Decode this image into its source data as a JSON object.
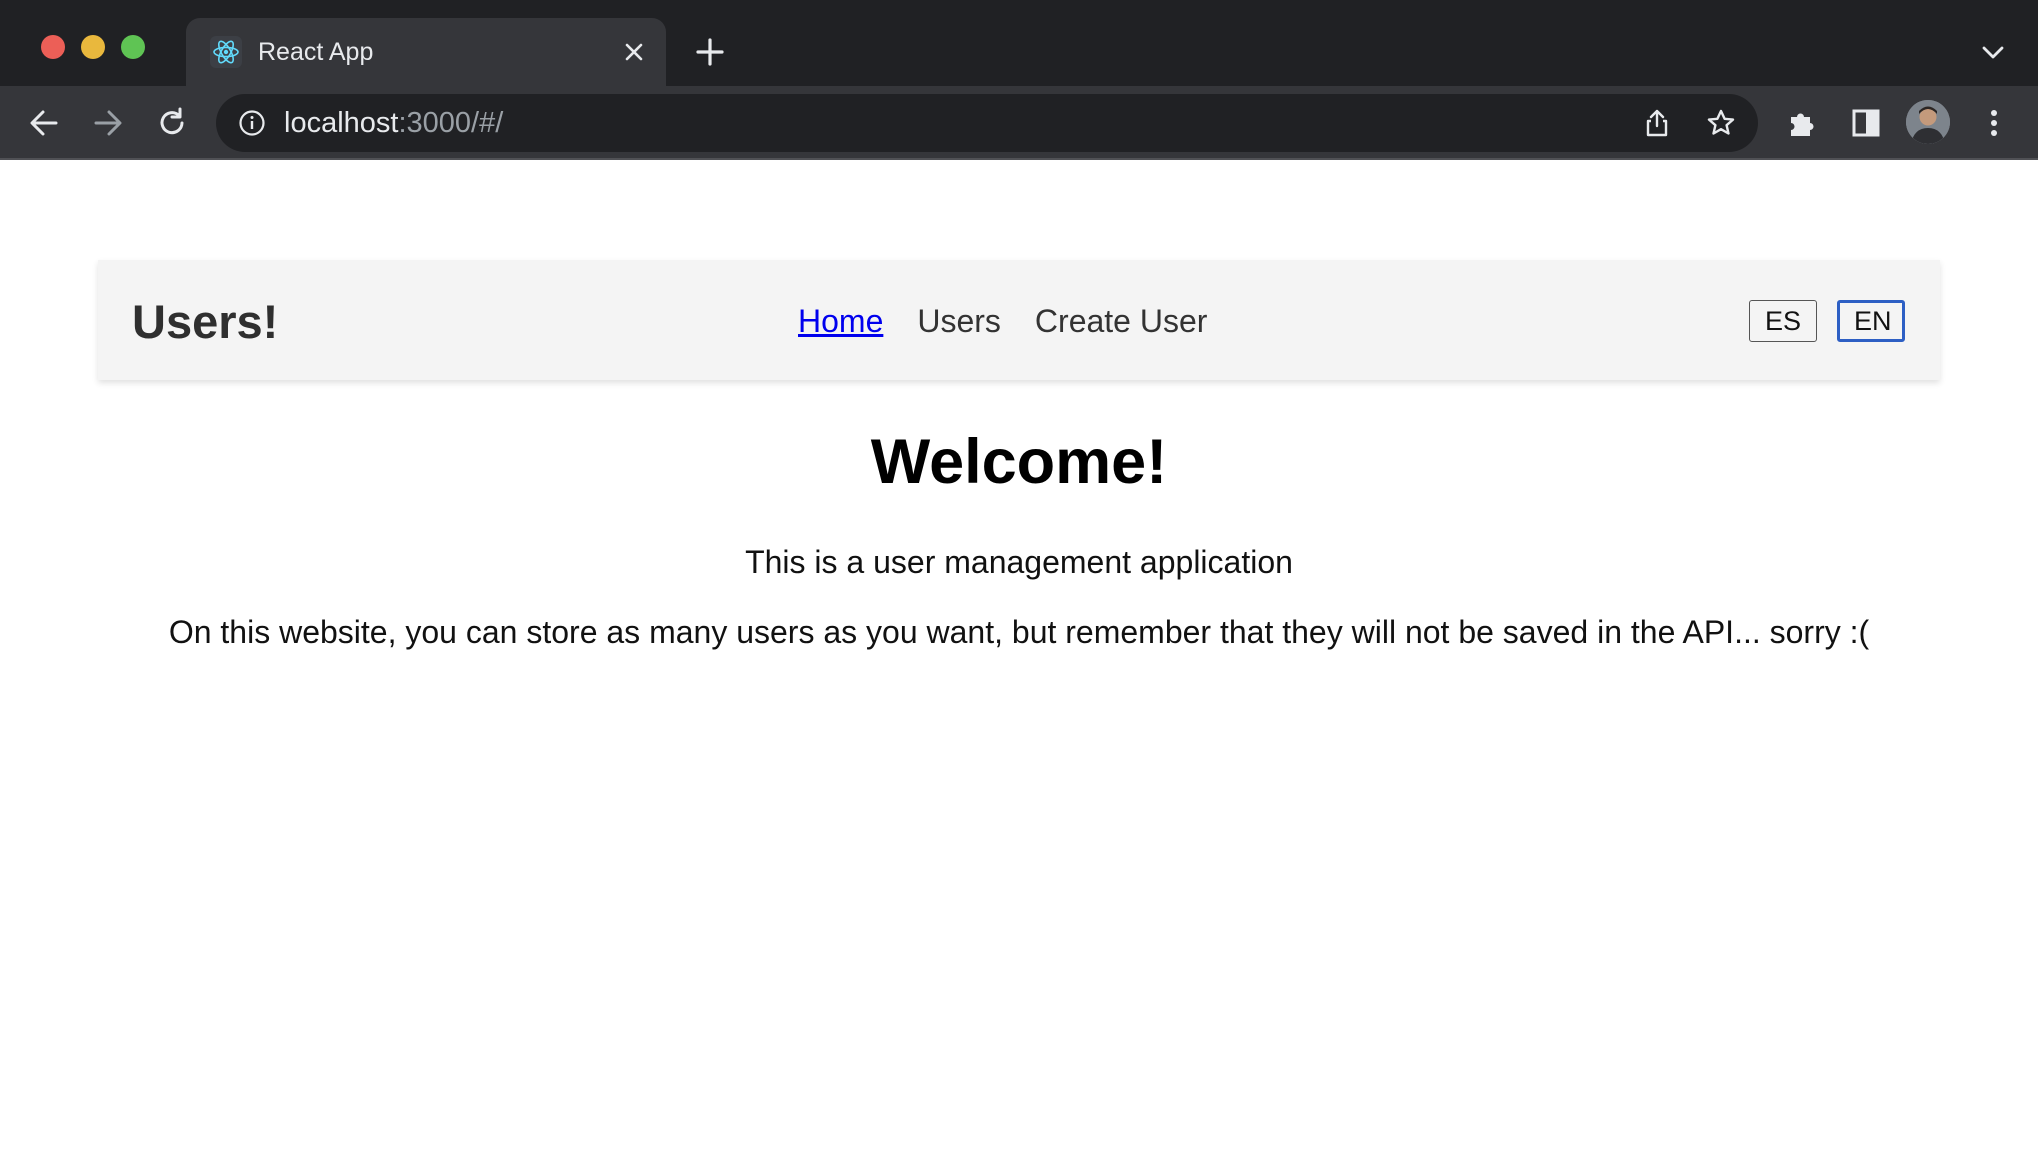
{
  "browser": {
    "tab_title": "React App",
    "url_host": "localhost",
    "url_rest": ":3000/#/",
    "icons": [
      "react-favicon",
      "close-icon",
      "plus-icon",
      "chevron-down-icon",
      "back-arrow-icon",
      "forward-arrow-icon",
      "reload-icon",
      "info-icon",
      "share-icon",
      "star-icon",
      "puzzle-icon",
      "sidepanel-icon",
      "avatar",
      "more-vertical-icon"
    ]
  },
  "app": {
    "brand": "Users!",
    "nav": [
      {
        "label": "Home",
        "active": true
      },
      {
        "label": "Users",
        "active": false
      },
      {
        "label": "Create User",
        "active": false
      }
    ],
    "lang_buttons": [
      "ES",
      "EN"
    ],
    "selected_lang": "EN",
    "accent_color": "#2d5fc4",
    "link_color": "#0000ee"
  },
  "main": {
    "heading": "Welcome!",
    "intro": "This is a user management application",
    "note": "On this website, you can store as many users as you want, but remember that they will not be saved in the API... sorry :("
  }
}
